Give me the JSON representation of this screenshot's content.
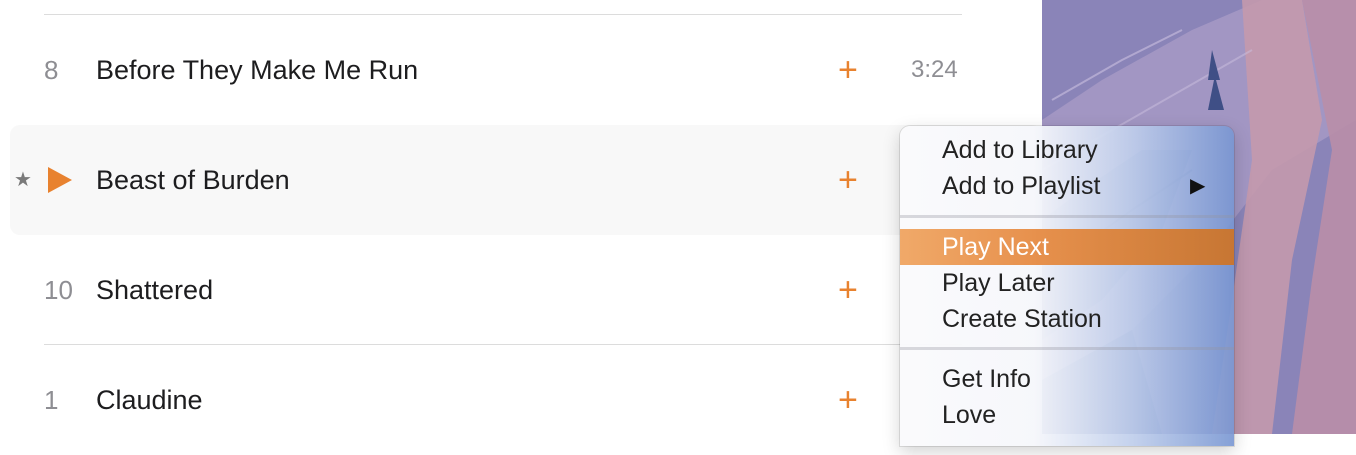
{
  "tracks": [
    {
      "number": "8",
      "title": "Before They Make Me Run",
      "duration": "3:24",
      "add_glyph": "+"
    },
    {
      "number": "",
      "title": "Beast of Burden",
      "duration": "",
      "add_glyph": "+",
      "star_glyph": "★",
      "playing": true
    },
    {
      "number": "10",
      "title": "Shattered",
      "duration": "",
      "add_glyph": "+"
    },
    {
      "number": "1",
      "title": "Claudine",
      "duration": "",
      "add_glyph": "+"
    }
  ],
  "context_menu": {
    "groups": [
      [
        {
          "label": "Add to Library"
        },
        {
          "label": "Add to Playlist",
          "submenu_arrow": "▶"
        }
      ],
      [
        {
          "label": "Play Next",
          "highlighted": true
        },
        {
          "label": "Play Later"
        },
        {
          "label": "Create Station"
        }
      ],
      [
        {
          "label": "Get Info"
        },
        {
          "label": "Love"
        }
      ]
    ]
  },
  "colors": {
    "accent": "#e8822f",
    "menu_highlight": "#e7914d"
  },
  "icons": {
    "add": "plus-icon",
    "play": "play-icon",
    "star": "star-icon",
    "submenu": "chevron-right-icon"
  }
}
